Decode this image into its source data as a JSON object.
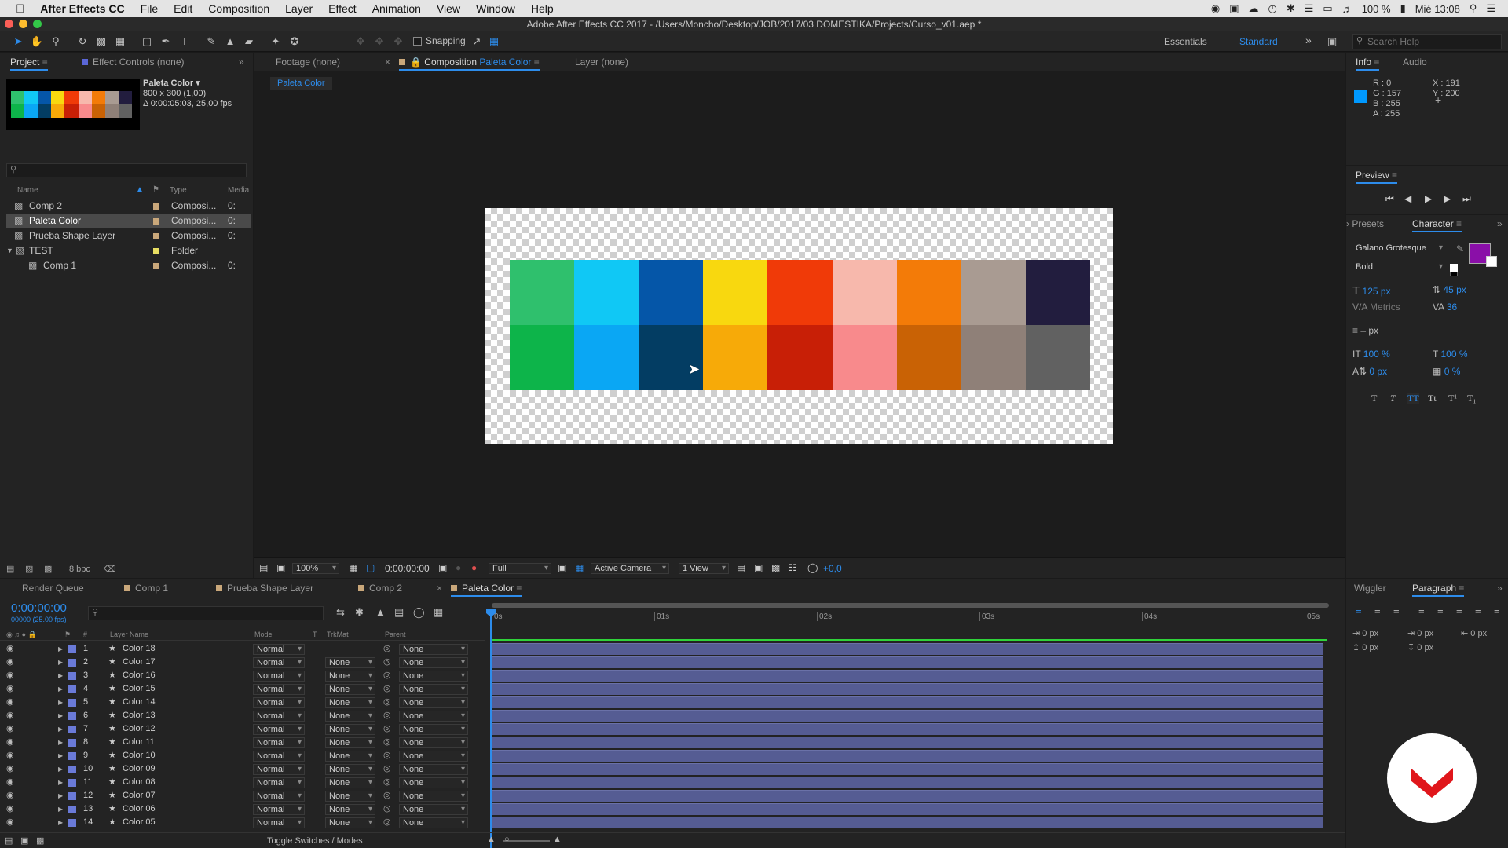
{
  "menubar": {
    "app_name": "After Effects CC",
    "items": [
      "File",
      "Edit",
      "Composition",
      "Layer",
      "Effect",
      "Animation",
      "View",
      "Window",
      "Help"
    ],
    "battery": "100 %",
    "clock": "Mié 13:08"
  },
  "window": {
    "title": "Adobe After Effects CC 2017 - /Users/Moncho/Desktop/JOB/2017/03 DOMESTIKA/Projects/Curso_v01.aep *"
  },
  "toolbar": {
    "snapping_label": "Snapping",
    "workspaces": [
      "Essentials",
      "Standard"
    ],
    "active_workspace": "Standard",
    "search_placeholder": "Search Help"
  },
  "project_panel": {
    "tabs": [
      "Project",
      "Effect Controls (none)"
    ],
    "preview": {
      "name": "Paleta Color ▾",
      "dims": "800 x 300 (1,00)",
      "duration": "Δ 0:00:05:03, 25,00 fps"
    },
    "columns": [
      "Name",
      "Type",
      "Media"
    ],
    "items": [
      {
        "name": "Comp 2",
        "type": "Composi...",
        "media": "0:"
      },
      {
        "name": "Paleta Color",
        "type": "Composi...",
        "media": "0:"
      },
      {
        "name": "Prueba Shape Layer",
        "type": "Composi...",
        "media": "0:"
      },
      {
        "name": "TEST",
        "type": "Folder",
        "media": ""
      },
      {
        "name": "Comp 1",
        "type": "Composi...",
        "media": "0:"
      }
    ],
    "bpc": "8 bpc"
  },
  "viewer": {
    "tabs": [
      "Footage (none)",
      "Composition",
      "Layer (none)"
    ],
    "comp_name": "Paleta Color",
    "sub_tab": "Paleta Color",
    "zoom": "100%",
    "timecode": "0:00:00:00",
    "resolution": "Full",
    "camera": "Active Camera",
    "views": "1 View",
    "exposure": "+0,0",
    "swatches_top": [
      "#2fc06d",
      "#10c8f5",
      "#0556a8",
      "#f8d80f",
      "#f03a08",
      "#f7b8ac",
      "#f37b08",
      "#a99b92",
      "#221d3e"
    ],
    "swatches_bottom": [
      "#0db44a",
      "#0aa7f4",
      "#033d63",
      "#f7aa08",
      "#c81f06",
      "#f88a8c",
      "#c96205",
      "#8f8078",
      "#616161"
    ]
  },
  "info_panel": {
    "tabs": [
      "Info",
      "Audio"
    ],
    "r": "R : 0",
    "g": "G : 157",
    "b": "B : 255",
    "a": "A : 255",
    "x": "X : 191",
    "y": "Y : 200",
    "swatch_color": "#0099ff"
  },
  "preview_panel": {
    "title": "Preview"
  },
  "character_panel": {
    "tabs": [
      "Presets",
      "Character"
    ],
    "font": "Galano Grotesque",
    "style": "Bold",
    "font_size": "125 px",
    "leading": "45 px",
    "kerning": "Metrics",
    "tracking": "36",
    "stroke": "– px",
    "vscale": "100 %",
    "hscale": "100 %",
    "baseline": "0 px",
    "tsume": "0 %",
    "fill_color": "#8a0fa8"
  },
  "paragraph_panel": {
    "tabs": [
      "Wiggler",
      "Paragraph"
    ],
    "indent_left": "0 px",
    "indent_first": "0 px",
    "indent_right": "0 px",
    "space_before": "0 px",
    "space_after": "0 px"
  },
  "timeline": {
    "tabs": [
      "Render Queue",
      "Comp 1",
      "Prueba Shape Layer",
      "Comp 2",
      "Paleta Color"
    ],
    "timecode": "0:00:00:00",
    "frame_info": "00000 (25.00 fps)",
    "columns": [
      "Layer Name",
      "Mode",
      "T",
      "TrkMat",
      "Parent"
    ],
    "ruler": [
      "0s",
      "01s",
      "02s",
      "03s",
      "04s",
      "05s"
    ],
    "layers": [
      {
        "num": "1",
        "name": "Color 18",
        "mode": "Normal",
        "trkmat": "",
        "parent": "None"
      },
      {
        "num": "2",
        "name": "Color 17",
        "mode": "Normal",
        "trkmat": "None",
        "parent": "None"
      },
      {
        "num": "3",
        "name": "Color 16",
        "mode": "Normal",
        "trkmat": "None",
        "parent": "None"
      },
      {
        "num": "4",
        "name": "Color 15",
        "mode": "Normal",
        "trkmat": "None",
        "parent": "None"
      },
      {
        "num": "5",
        "name": "Color 14",
        "mode": "Normal",
        "trkmat": "None",
        "parent": "None"
      },
      {
        "num": "6",
        "name": "Color 13",
        "mode": "Normal",
        "trkmat": "None",
        "parent": "None"
      },
      {
        "num": "7",
        "name": "Color 12",
        "mode": "Normal",
        "trkmat": "None",
        "parent": "None"
      },
      {
        "num": "8",
        "name": "Color 11",
        "mode": "Normal",
        "trkmat": "None",
        "parent": "None"
      },
      {
        "num": "9",
        "name": "Color 10",
        "mode": "Normal",
        "trkmat": "None",
        "parent": "None"
      },
      {
        "num": "10",
        "name": "Color 09",
        "mode": "Normal",
        "trkmat": "None",
        "parent": "None"
      },
      {
        "num": "11",
        "name": "Color 08",
        "mode": "Normal",
        "trkmat": "None",
        "parent": "None"
      },
      {
        "num": "12",
        "name": "Color 07",
        "mode": "Normal",
        "trkmat": "None",
        "parent": "None"
      },
      {
        "num": "13",
        "name": "Color 06",
        "mode": "Normal",
        "trkmat": "None",
        "parent": "None"
      },
      {
        "num": "14",
        "name": "Color 05",
        "mode": "Normal",
        "trkmat": "None",
        "parent": "None"
      }
    ],
    "footer": "Toggle Switches / Modes"
  },
  "colors": {
    "accent": "#2d8ceb",
    "layer_label": "#6a7ad8",
    "bar": "#555c93",
    "green_line": "#2fd33a",
    "logo_red": "#e0161b"
  }
}
